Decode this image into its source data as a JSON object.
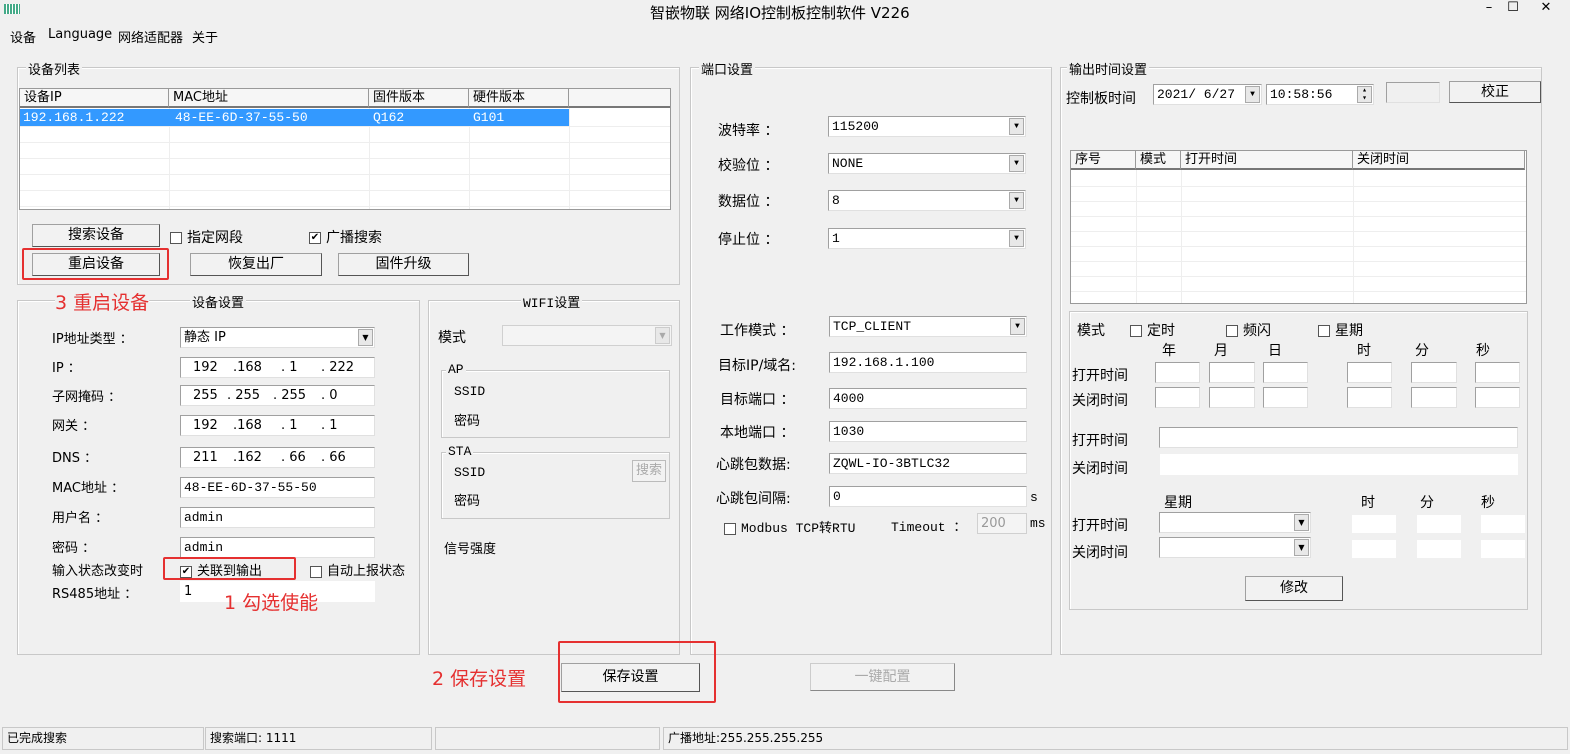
{
  "window": {
    "title": "智嵌物联 网络IO控制板控制软件   V226",
    "minimize": "–",
    "maximize": "☐",
    "close": "✕"
  },
  "menu": [
    "设备",
    "Language",
    "网络适配器",
    "关于"
  ],
  "device_list": {
    "title": "设备列表",
    "columns": [
      "设备IP",
      "MAC地址",
      "固件版本",
      "硬件版本"
    ],
    "rows": [
      [
        "192.168.1.222",
        "48-EE-6D-37-55-50",
        "Q162",
        "G101"
      ]
    ],
    "search_btn": "搜索设备",
    "segment_cb": "指定网段",
    "broadcast_cb": "广播搜索",
    "restart_btn": "重启设备",
    "factory_btn": "恢复出厂",
    "firmware_btn": "固件升级"
  },
  "annotations": {
    "a1": "1 勾选使能",
    "a2": "2 保存设置",
    "a3": "3 重启设备"
  },
  "device_settings": {
    "title": "设备设置",
    "ip_type_label": "IP地址类型 ：",
    "ip_type": "静态 IP",
    "ip_label": "IP          ：",
    "ip": [
      "192",
      ".168",
      ". 1",
      ". 222"
    ],
    "mask_label": "子网掩码 ：",
    "mask": [
      "255",
      ". 255",
      ". 255",
      ".  0"
    ],
    "gw_label": "网关        ：",
    "gw": [
      "192",
      ".168",
      ". 1",
      ".  1"
    ],
    "dns_label": "DNS         ：",
    "dns": [
      "211",
      ".162",
      ". 66",
      ". 66"
    ],
    "mac_label": "MAC地址   ：",
    "mac": "48-EE-6D-37-55-50",
    "user_label": "用户名     ：",
    "user": "admin",
    "pwd_label": "密码        ：",
    "pwd": "admin",
    "input_change_label": "输入状态改变时",
    "link_output_cb": "关联到输出",
    "auto_report_cb": "自动上报状态",
    "rs485_label": "RS485地址  ：",
    "rs485": "1"
  },
  "wifi": {
    "title": "WIFI设置",
    "mode_label": "模式",
    "ap": "AP",
    "sta": "STA",
    "ssid": "SSID",
    "pwd": "密码",
    "search_btn": "搜索",
    "signal": "信号强度"
  },
  "port": {
    "title": "端口设置",
    "baud_label": "波特率   ：",
    "baud": "115200",
    "parity_label": "校验位   ：",
    "parity": "NONE",
    "data_label": "数据位   ：",
    "data": "8",
    "stop_label": "停止位   ：",
    "stop": "1",
    "mode_label": "工作模式 ：",
    "mode": "TCP_CLIENT",
    "target_ip_label": "目标IP/域名:",
    "target_ip": "192.168.1.100",
    "target_port_label": "目标端口 ：",
    "target_port": "4000",
    "local_port_label": "本地端口 ：",
    "local_port": "1030",
    "hb_data_label": "心跳包数据:",
    "hb_data": "ZQWL-IO-3BTLC32",
    "hb_int_label": "心跳包间隔:",
    "hb_int": "0",
    "s": "s",
    "modbus_cb": "Modbus TCP转RTU",
    "timeout_label": "Timeout ：",
    "timeout": "200",
    "ms": "ms"
  },
  "output_time": {
    "title": "输出时间设置",
    "board_time_label": "控制板时间",
    "date": "2021/ 6/27",
    "time": "10:58:56",
    "calibrate_btn": "校正",
    "columns": [
      "序号",
      "模式",
      "打开时间",
      "关闭时间"
    ],
    "mode_label": "模式",
    "timer_cb": "定时",
    "flash_cb": "频闪",
    "week_cb": "星期",
    "ymd": [
      "年",
      "月",
      "日"
    ],
    "hms": [
      "时",
      "分",
      "秒"
    ],
    "open": "打开时间",
    "close": "关闭时间",
    "week": "星期",
    "modify_btn": "修改"
  },
  "save_btn": "保存设置",
  "one_key_btn": "一键配置",
  "status": [
    "已完成搜索",
    "搜索端口: 1111",
    "",
    "广播地址:255.255.255.255"
  ]
}
